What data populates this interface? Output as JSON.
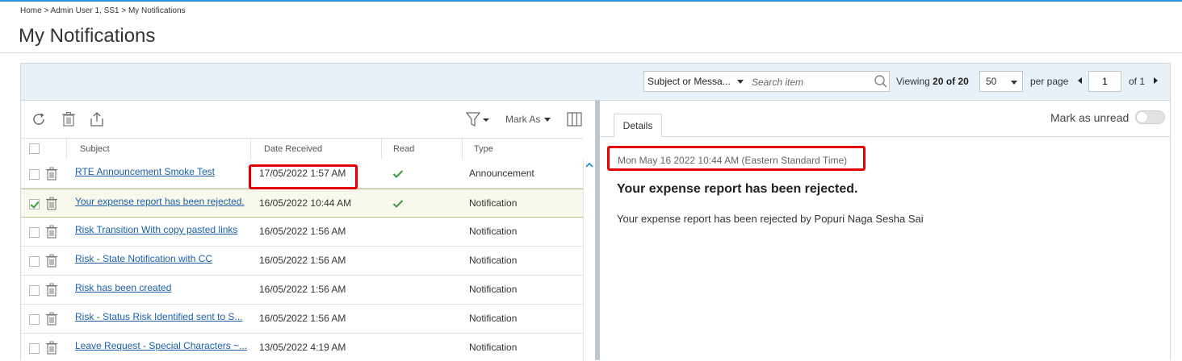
{
  "breadcrumb": "Home > Admin User 1, SS1 > My Notifications",
  "page_title": "My Notifications",
  "search": {
    "filter_label": "Subject or Messa...",
    "placeholder": "Search item"
  },
  "pagination": {
    "viewing_prefix": "Viewing",
    "viewing_range": "20 of 20",
    "per_page_value": "50",
    "per_page_label": "per page",
    "page_value": "1",
    "page_of": "of 1"
  },
  "toolbar": {
    "refresh_icon": "refresh-icon",
    "delete_icon": "trash-icon",
    "export_icon": "export-icon",
    "filter_icon": "filter-icon",
    "mark_as_label": "Mark As",
    "columns_icon": "columns-icon"
  },
  "columns": {
    "subject": "Subject",
    "date_received": "Date Received",
    "read": "Read",
    "type": "Type"
  },
  "rows": [
    {
      "subject": "RTE Announcement Smoke Test",
      "date": "17/05/2022 1:57 AM",
      "read": true,
      "type": "Announcement",
      "checked": false,
      "selected": false
    },
    {
      "subject": "Your expense report has been rejected.",
      "date": "16/05/2022 10:44 AM",
      "read": true,
      "type": "Notification",
      "checked": true,
      "selected": true
    },
    {
      "subject": "Risk Transition With copy pasted links",
      "date": "16/05/2022 1:56 AM",
      "read": false,
      "type": "Notification",
      "checked": false,
      "selected": false
    },
    {
      "subject": "Risk - State Notification with CC",
      "date": "16/05/2022 1:56 AM",
      "read": false,
      "type": "Notification",
      "checked": false,
      "selected": false
    },
    {
      "subject": "Risk has been created",
      "date": "16/05/2022 1:56 AM",
      "read": false,
      "type": "Notification",
      "checked": false,
      "selected": false
    },
    {
      "subject": "Risk - Status Risk Identified sent to S...",
      "date": "16/05/2022 1:56 AM",
      "read": false,
      "type": "Notification",
      "checked": false,
      "selected": false
    },
    {
      "subject": "Leave Request - Special Characters ~...",
      "date": "13/05/2022 4:19 AM",
      "read": false,
      "type": "Notification",
      "checked": false,
      "selected": false
    }
  ],
  "details": {
    "tab_label": "Details",
    "mark_unread_label": "Mark as unread",
    "mark_unread_on": false,
    "date": "Mon May 16 2022 10:44 AM (Eastern Standard Time)",
    "subject": "Your expense report has been rejected.",
    "body": "Your expense report has been rejected by Popuri Naga Sesha Sai"
  },
  "colors": {
    "accent": "#2a8fd4",
    "link": "#1a5fa8",
    "highlight": "#e00000",
    "check": "#3a9c3a"
  }
}
